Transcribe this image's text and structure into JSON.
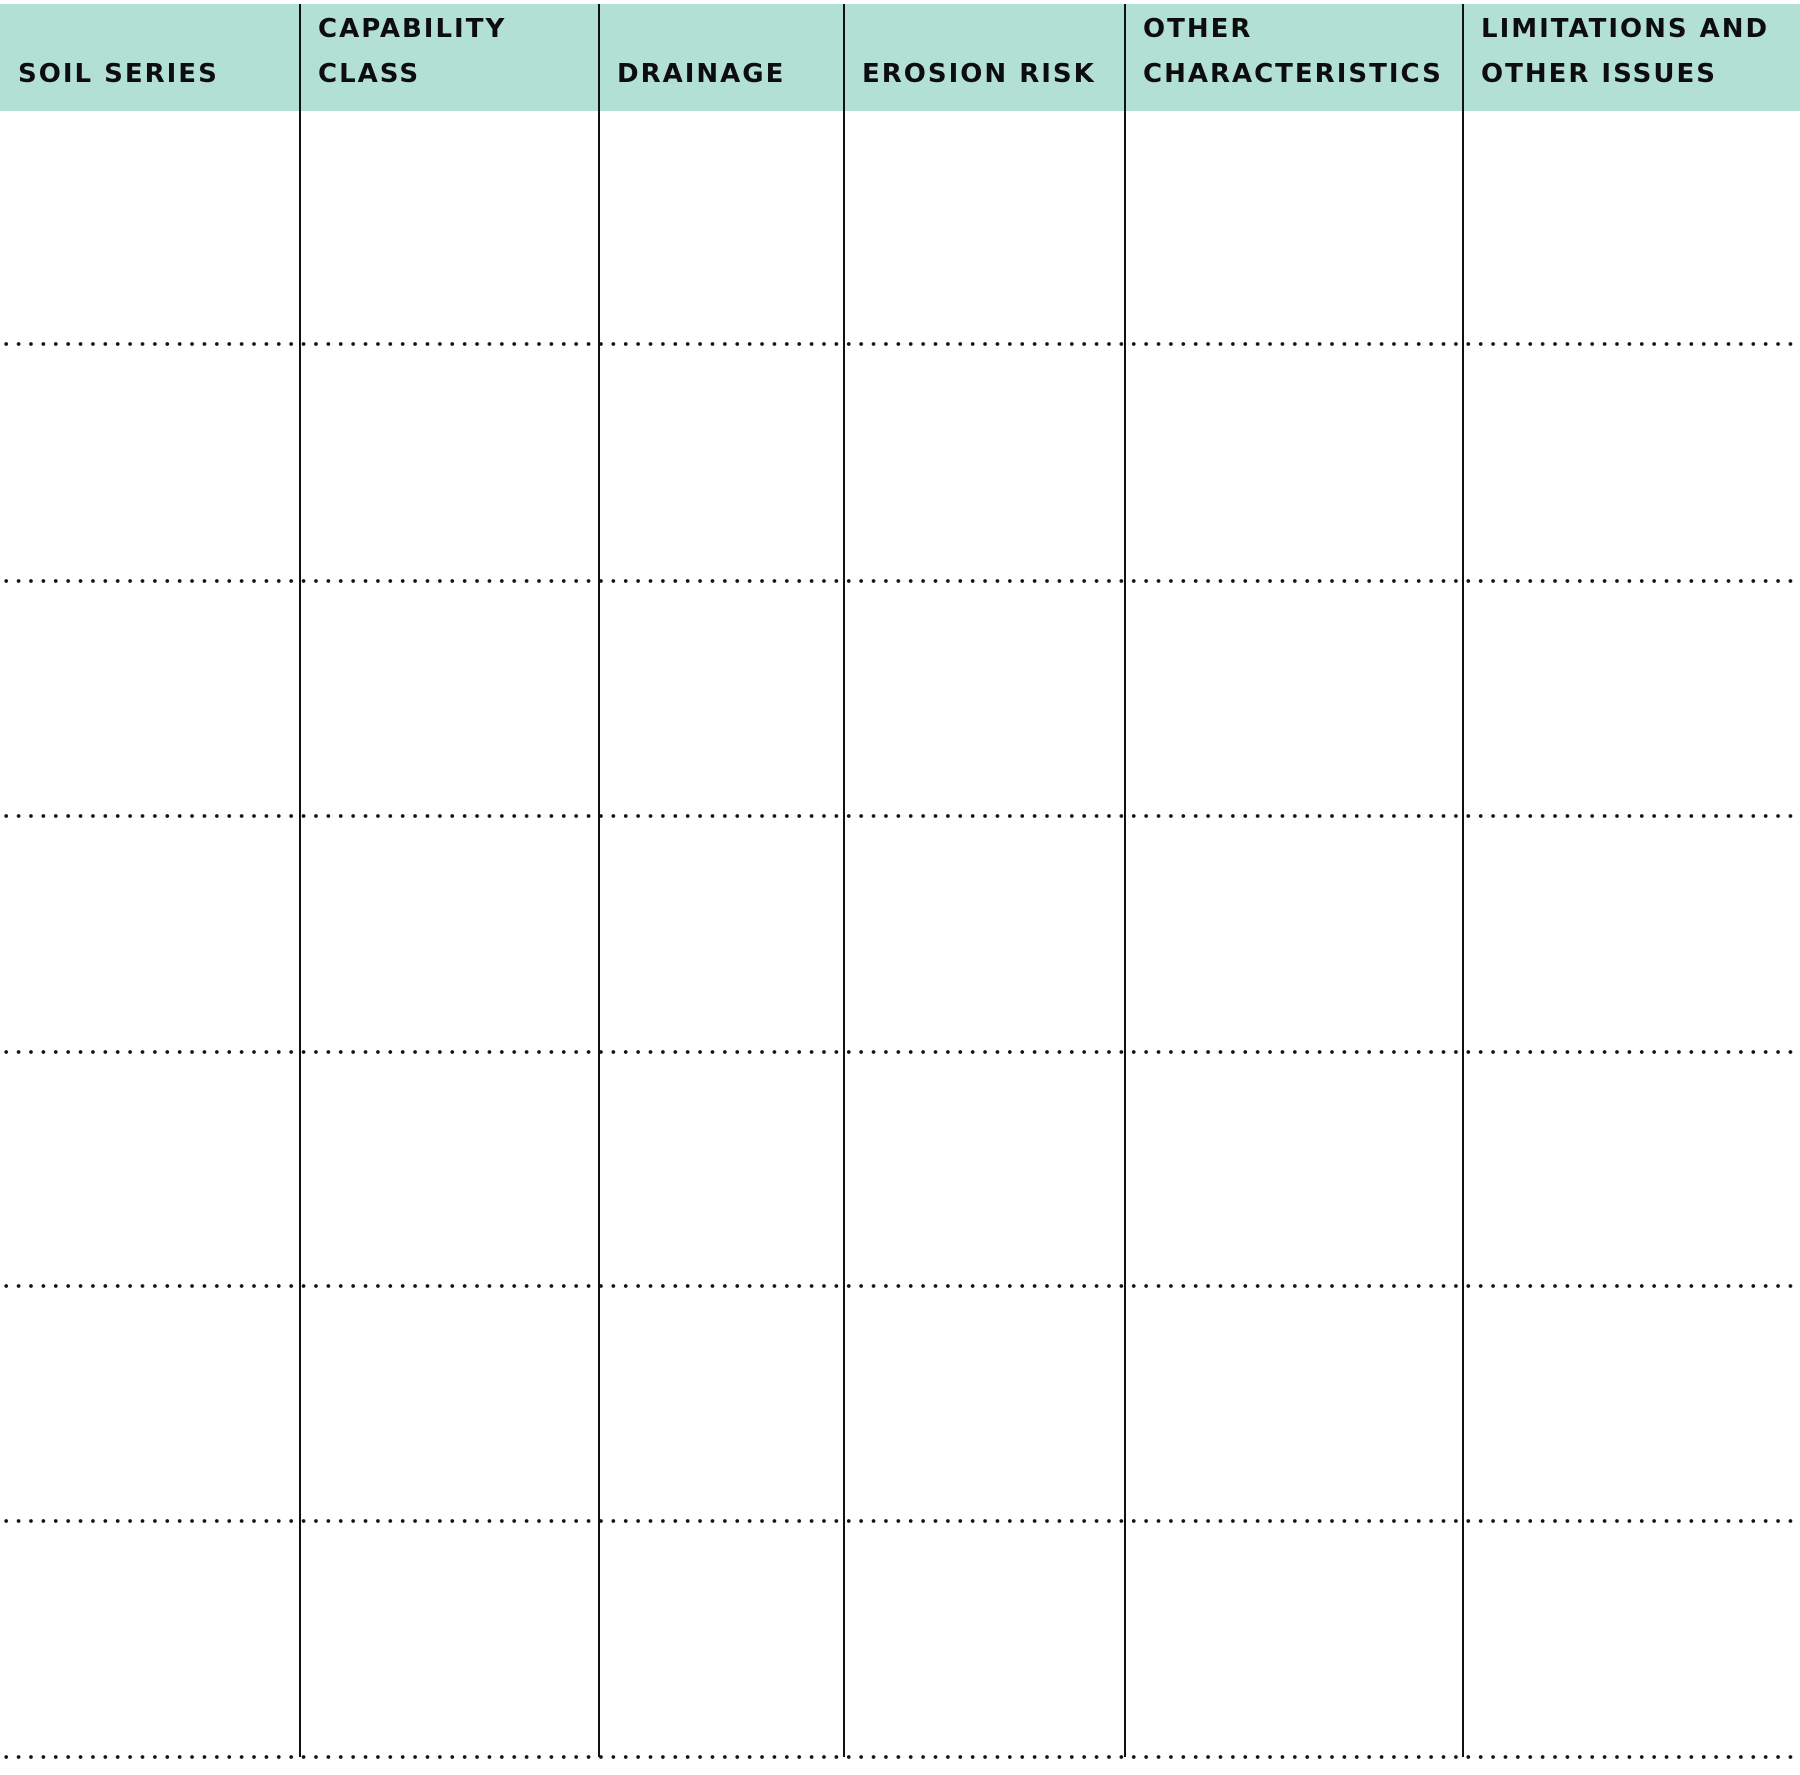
{
  "table": {
    "header_color": "#b2e0d4",
    "columns": [
      {
        "line1": "",
        "line2": "SOIL SERIES"
      },
      {
        "line1": "CAPABILITY",
        "line2": "CLASS"
      },
      {
        "line1": "",
        "line2": "DRAINAGE"
      },
      {
        "line1": "",
        "line2": "EROSION RISK"
      },
      {
        "line1": "OTHER",
        "line2": "CHARACTERISTICS"
      },
      {
        "line1": "LIMITATIONS AND",
        "line2": "OTHER ISSUES"
      }
    ],
    "rows": [
      [
        "",
        "",
        "",
        "",
        "",
        ""
      ],
      [
        "",
        "",
        "",
        "",
        "",
        ""
      ],
      [
        "",
        "",
        "",
        "",
        "",
        ""
      ],
      [
        "",
        "",
        "",
        "",
        "",
        ""
      ],
      [
        "",
        "",
        "",
        "",
        "",
        ""
      ],
      [
        "",
        "",
        "",
        "",
        "",
        ""
      ],
      [
        "",
        "",
        "",
        "",
        "",
        ""
      ]
    ]
  }
}
